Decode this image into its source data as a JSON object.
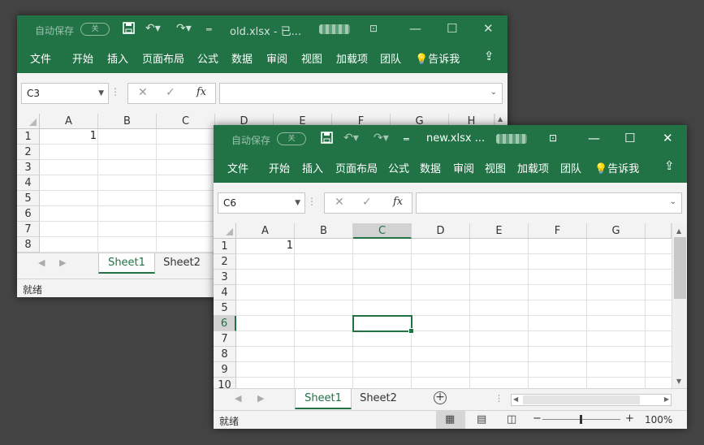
{
  "back_window": {
    "autosave_label": "自动保存",
    "autosave_state": "关",
    "title": "old.xlsx  -  已...",
    "ribbon_tabs": [
      "文件",
      "开始",
      "插入",
      "页面布局",
      "公式",
      "数据",
      "审阅",
      "视图",
      "加载项",
      "团队",
      "告诉我"
    ],
    "name_box": "C3",
    "formula": "",
    "columns": [
      "A",
      "B",
      "C",
      "D",
      "E",
      "F",
      "G",
      "H"
    ],
    "rows": [
      "1",
      "2",
      "3",
      "4",
      "5",
      "6",
      "7",
      "8"
    ],
    "cell_a1": "1",
    "sheets": [
      "Sheet1",
      "Sheet2"
    ],
    "active_sheet": "Sheet1",
    "status": "就绪"
  },
  "front_window": {
    "autosave_label": "自动保存",
    "autosave_state": "关",
    "title": "new.xlsx  ...",
    "ribbon_tabs": [
      "文件",
      "开始",
      "插入",
      "页面布局",
      "公式",
      "数据",
      "审阅",
      "视图",
      "加载项",
      "团队",
      "告诉我"
    ],
    "name_box": "C6",
    "formula": "",
    "columns": [
      "A",
      "B",
      "C",
      "D",
      "E",
      "F",
      "G"
    ],
    "rows": [
      "1",
      "2",
      "3",
      "4",
      "5",
      "6",
      "7",
      "8",
      "9",
      "10"
    ],
    "cell_a1": "1",
    "selected_cell": "C6",
    "sheets": [
      "Sheet1",
      "Sheet2"
    ],
    "active_sheet": "Sheet1",
    "status": "就绪",
    "zoom": "100%"
  },
  "icons": {
    "save": "save-icon",
    "undo": "undo-icon",
    "redo": "redo-icon",
    "customize": "customize-qat-icon",
    "display_options": "ribbon-display-icon",
    "minimize": "minimize-icon",
    "maximize": "maximize-icon",
    "close": "close-icon",
    "tell_me": "lightbulb-icon",
    "share": "share-icon"
  },
  "colors": {
    "accent": "#217346",
    "desktop": "#444444"
  }
}
